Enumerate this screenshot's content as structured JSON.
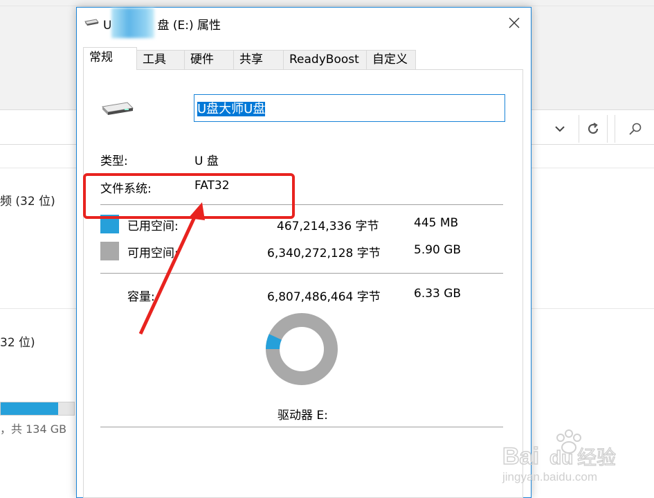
{
  "background_window": {
    "row1_text": "频 (32 位)",
    "row2_text": "32 位)",
    "drive_free_text": "，共 134 GB",
    "drive_usage_fraction": 0.78,
    "icons": [
      "chevron-down-icon",
      "refresh-icon",
      "search-icon"
    ]
  },
  "dialog": {
    "title_prefix": "U",
    "title_suffix": "盘 (E:) 属性",
    "close_icon": "close-icon",
    "tabs": [
      {
        "label": "常规",
        "active": true
      },
      {
        "label": "工具",
        "active": false
      },
      {
        "label": "硬件",
        "active": false
      },
      {
        "label": "共享",
        "active": false
      },
      {
        "label": "ReadyBoost",
        "active": false
      },
      {
        "label": "自定义",
        "active": false
      }
    ],
    "drive_name_value": "U盘大师U盘",
    "type_label": "类型:",
    "type_value": "U 盘",
    "fs_label": "文件系统:",
    "fs_value": "FAT32",
    "used_label": "已用空间:",
    "used_bytes": "467,214,336 字节",
    "used_size": "445 MB",
    "free_label": "可用空间:",
    "free_bytes": "6,340,272,128 字节",
    "free_size": "5.90 GB",
    "capacity_label": "容量:",
    "capacity_bytes": "6,807,486,464 字节",
    "capacity_size": "6.33 GB",
    "drive_label": "驱动器 E:",
    "used_fraction": 0.0686,
    "colors": {
      "used": "#26a0da",
      "free": "#a9a9a9",
      "accent": "#1883d7",
      "annotation": "#e8231f"
    }
  },
  "watermark": {
    "brand": "Bai du 经验",
    "url": "jingyan.baidu.com"
  }
}
